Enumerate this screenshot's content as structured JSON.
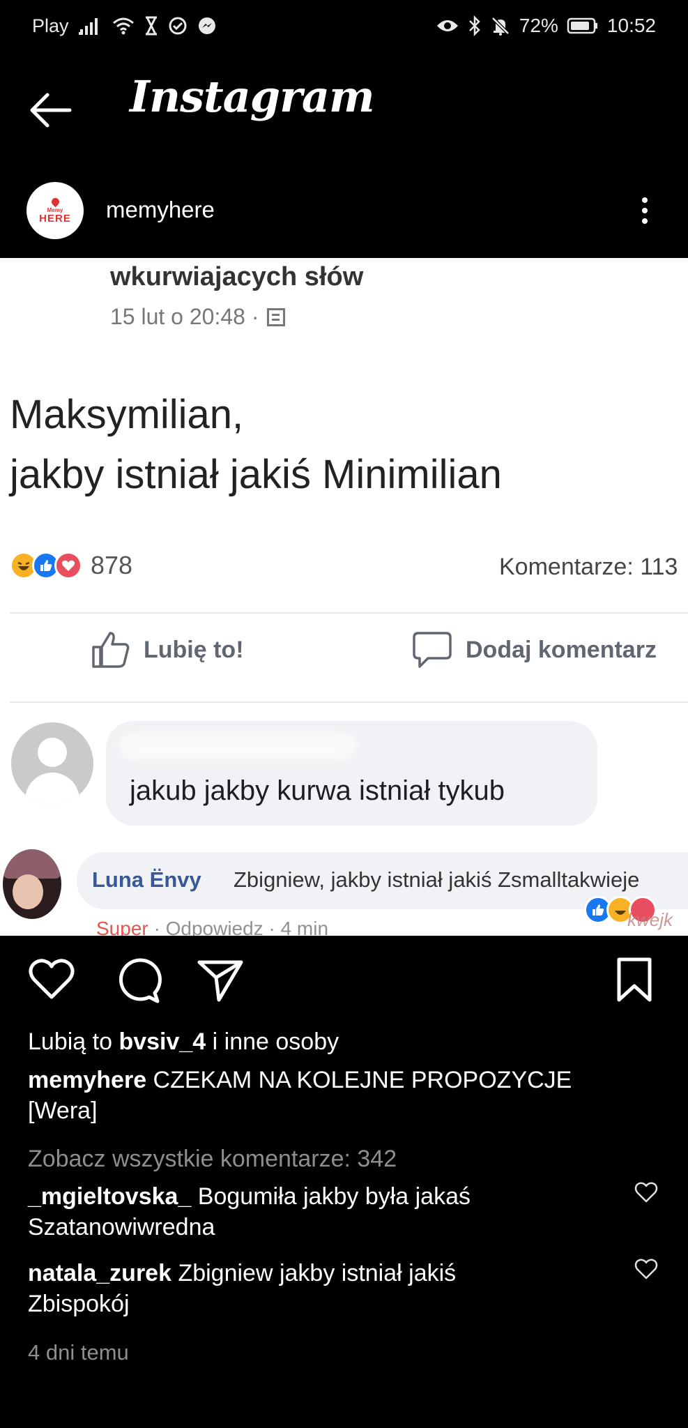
{
  "status_bar": {
    "carrier": "Play",
    "battery": "72%",
    "time": "10:52",
    "icons_left": [
      "signal-icon",
      "wifi-icon",
      "hourglass-icon",
      "check-circle-icon",
      "messenger-icon"
    ],
    "icons_right": [
      "eye-icon",
      "bluetooth-icon",
      "mute-bell-icon",
      "battery-icon"
    ]
  },
  "app_bar": {
    "title": "Instagram"
  },
  "post_header": {
    "avatar_text_small": "Memy",
    "avatar_text_big": "HERE",
    "username": "memyhere"
  },
  "post_image": {
    "group_name": "wkurwiajacych słów",
    "date": "15 lut o 20:48 ·",
    "text_line1": "Maksymilian,",
    "text_line2": "jakby istniał jakiś Minimilian",
    "reaction_count": "878",
    "comments_count": "Komentarze: 113",
    "like_label": "Lubię to!",
    "comment_label": "Dodaj komentarz",
    "comment_text": "jakub jakby kurwa istniał tykub",
    "reply_name": "Luna Ënvy",
    "reply_text": "Zbigniew, jakby istniał jakiś Zsmalltakwieje",
    "reply_meta_super": "Super",
    "reply_meta_rest": " · Odpowiedz · 4 min",
    "watermark": "kwejk"
  },
  "actions": {
    "like": "heart-icon",
    "comment": "comment-icon",
    "share": "send-icon",
    "save": "bookmark-icon"
  },
  "caption": {
    "likes_prefix": "Lubią to ",
    "likes_user": "bvsiv_4",
    "likes_suffix": " i inne osoby",
    "author": "memyhere",
    "text_line1": " CZEKAM NA KOLEJNE PROPOZYCJE",
    "text_line2": "[Wera]",
    "view_all": "Zobacz wszystkie komentarze: 342",
    "comments": [
      {
        "user": "_mgieltovska_",
        "line1": " Bogumiła jakby była jakaś",
        "line2": "Szatanowiwredna"
      },
      {
        "user": "natala_zurek",
        "line1": " Zbigniew jakby istniał jakiś",
        "line2": "Zbispokój"
      }
    ],
    "time_ago": "4 dni temu"
  }
}
